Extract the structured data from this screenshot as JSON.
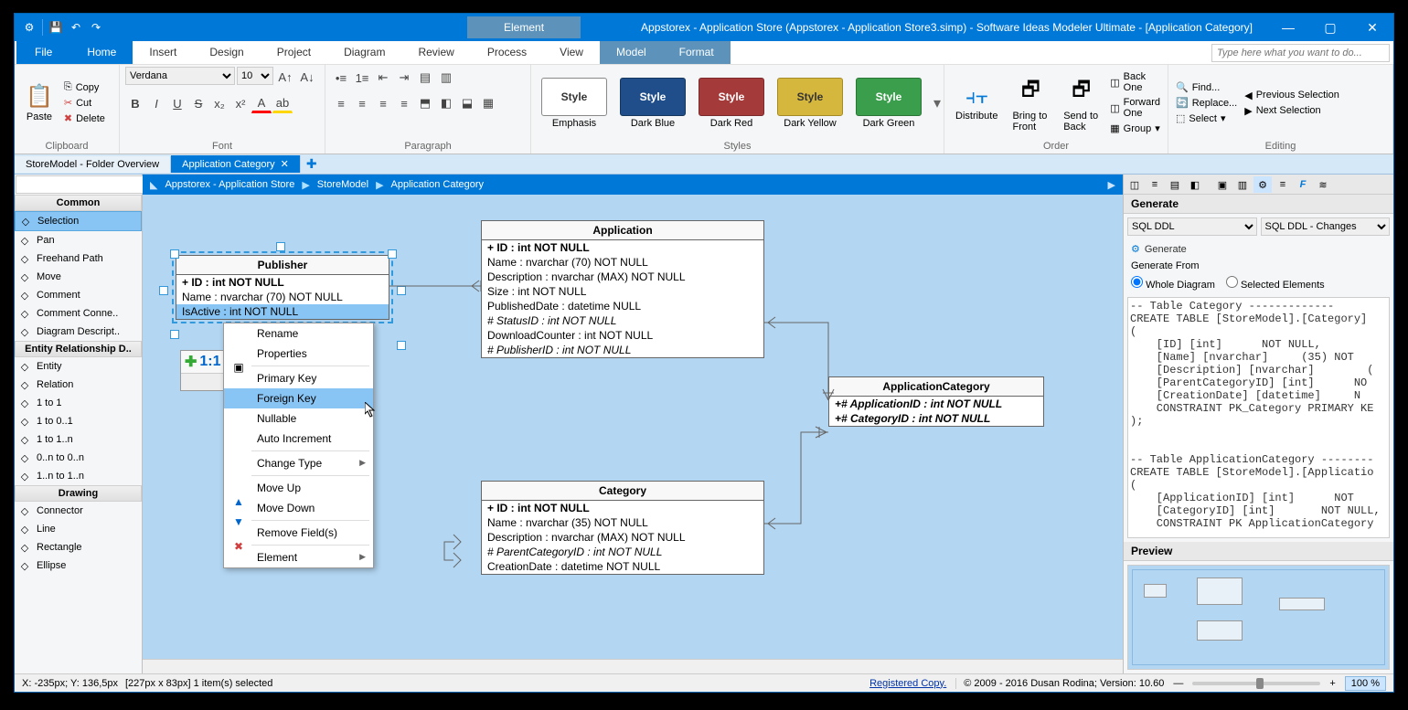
{
  "window": {
    "contextual_tab": "Element",
    "title": "Appstorex - Application Store (Appstorex - Application Store3.simp)  - Software Ideas Modeler Ultimate - [Application Category]"
  },
  "menu": {
    "file": "File",
    "tabs": [
      "Home",
      "Insert",
      "Design",
      "Project",
      "Diagram",
      "Review",
      "Process",
      "View",
      "Model",
      "Format"
    ],
    "search_placeholder": "Type here what you want to do..."
  },
  "ribbon": {
    "clipboard": {
      "paste": "Paste",
      "copy": "Copy",
      "cut": "Cut",
      "delete": "Delete",
      "label": "Clipboard"
    },
    "font": {
      "family": "Verdana",
      "size": "10",
      "label": "Font"
    },
    "paragraph": {
      "label": "Paragraph"
    },
    "styles": {
      "label": "Styles",
      "items": [
        {
          "name": "Style",
          "sub": "Emphasis",
          "bg": "#ffffff",
          "fg": "#333",
          "border": "#888"
        },
        {
          "name": "Style",
          "sub": "Dark Blue",
          "bg": "#204e8a",
          "fg": "#fff",
          "border": "#15365d"
        },
        {
          "name": "Style",
          "sub": "Dark Red",
          "bg": "#a53a3a",
          "fg": "#fff",
          "border": "#7a2a2a"
        },
        {
          "name": "Style",
          "sub": "Dark Yellow",
          "bg": "#d6b73d",
          "fg": "#333",
          "border": "#a58a28"
        },
        {
          "name": "Style",
          "sub": "Dark Green",
          "bg": "#3b9e4c",
          "fg": "#fff",
          "border": "#2b7537"
        }
      ]
    },
    "order": {
      "distribute": "Distribute",
      "bring_front": "Bring to Front",
      "send_back": "Send to Back",
      "back_one": "Back One",
      "forward_one": "Forward One",
      "group": "Group",
      "label": "Order"
    },
    "editing": {
      "find": "Find...",
      "replace": "Replace...",
      "select": "Select",
      "prev_sel": "Previous Selection",
      "next_sel": "Next Selection",
      "label": "Editing"
    }
  },
  "doc_tabs": {
    "tab1": "StoreModel - Folder Overview",
    "tab2": "Application Category"
  },
  "breadcrumb": [
    "Appstorex - Application Store",
    "StoreModel",
    "Application Category"
  ],
  "toolbox": {
    "common": "Common",
    "common_items": [
      "Selection",
      "Pan",
      "Freehand Path",
      "Move",
      "Comment",
      "Comment Conne..",
      "Diagram Descript.."
    ],
    "erd": "Entity Relationship D..",
    "erd_items": [
      "Entity",
      "Relation",
      "1 to 1",
      "1 to 0..1",
      "1 to 1..n",
      "0..n to 0..n",
      "1..n to 1..n"
    ],
    "drawing": "Drawing",
    "drawing_items": [
      "Connector",
      "Line",
      "Rectangle",
      "Ellipse"
    ]
  },
  "entities": {
    "publisher": {
      "title": "Publisher",
      "fields": [
        {
          "t": "+ ID : int NOT NULL",
          "pk": true
        },
        {
          "t": "Name : nvarchar (70)  NOT NULL"
        },
        {
          "t": "IsActive : int NOT NULL",
          "hl": true
        }
      ]
    },
    "application": {
      "title": "Application",
      "fields": [
        {
          "t": "+ ID : int NOT NULL",
          "pk": true
        },
        {
          "t": "Name : nvarchar (70)  NOT NULL"
        },
        {
          "t": "Description : nvarchar (MAX)  NOT NULL"
        },
        {
          "t": "Size : int NOT NULL"
        },
        {
          "t": "PublishedDate : datetime NULL"
        },
        {
          "t": "# StatusID : int NOT NULL",
          "fk": true
        },
        {
          "t": "DownloadCounter : int NOT NULL"
        },
        {
          "t": "# PublisherID : int NOT NULL",
          "fk": true
        }
      ]
    },
    "appcat": {
      "title": "ApplicationCategory",
      "fields": [
        {
          "t": "+# ApplicationID : int NOT NULL",
          "pk": true,
          "fk": true
        },
        {
          "t": "+# CategoryID : int NOT NULL",
          "pk": true,
          "fk": true
        }
      ]
    },
    "category": {
      "title": "Category",
      "fields": [
        {
          "t": "+ ID : int NOT NULL",
          "pk": true
        },
        {
          "t": "Name : nvarchar (35)  NOT NULL"
        },
        {
          "t": "Description : nvarchar (MAX)  NOT NULL"
        },
        {
          "t": "# ParentCategoryID : int NOT NULL",
          "fk": true
        },
        {
          "t": "CreationDate : datetime NOT NULL"
        }
      ]
    },
    "relbox": {
      "label": "1:1"
    }
  },
  "context_menu": {
    "items": [
      {
        "t": "Rename"
      },
      {
        "t": "Properties",
        "icon": "props"
      },
      {
        "sep": true
      },
      {
        "t": "Primary Key"
      },
      {
        "t": "Foreign Key",
        "hover": true
      },
      {
        "t": "Nullable"
      },
      {
        "t": "Auto Increment"
      },
      {
        "sep": true
      },
      {
        "t": "Change Type",
        "sub": true
      },
      {
        "sep": true
      },
      {
        "t": "Move Up",
        "icon": "up"
      },
      {
        "t": "Move Down",
        "icon": "down"
      },
      {
        "sep": true
      },
      {
        "t": "Remove Field(s)",
        "icon": "remove"
      },
      {
        "sep": true
      },
      {
        "t": "Element",
        "sub": true
      }
    ]
  },
  "generate": {
    "title": "Generate",
    "dd1": "SQL DDL",
    "dd2": "SQL DDL - Changes",
    "btn": "Generate",
    "from": "Generate From",
    "whole": "Whole Diagram",
    "selected": "Selected Elements"
  },
  "sql": "-- Table Category -------------\nCREATE TABLE [StoreModel].[Category]\n(\n    [ID] [int]      NOT NULL,\n    [Name] [nvarchar]     (35) NOT\n    [Description] [nvarchar]        (\n    [ParentCategoryID] [int]      NO\n    [CreationDate] [datetime]     N\n    CONSTRAINT PK_Category PRIMARY KE\n);\n\n\n-- Table ApplicationCategory --------\nCREATE TABLE [StoreModel].[Applicatio\n(\n    [ApplicationID] [int]      NOT\n    [CategoryID] [int]       NOT NULL,\n    CONSTRAINT PK ApplicationCategory",
  "preview": {
    "title": "Preview"
  },
  "status": {
    "coords": "X: -235px; Y: 136,5px",
    "sel": "[227px x 83px] 1 item(s) selected",
    "reg": "Registered Copy.",
    "copy": "© 2009 - 2016 Dusan Rodina; Version: 10.60",
    "zoom": "100 %"
  }
}
